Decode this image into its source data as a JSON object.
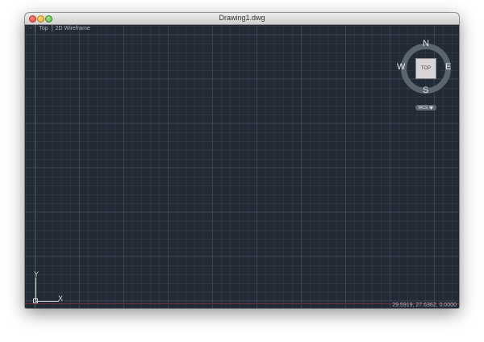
{
  "window": {
    "title": "Drawing1.dwg"
  },
  "viewport": {
    "menu_icon": "-",
    "view_label": "Top",
    "style_label": "2D Wireframe"
  },
  "viewcube": {
    "north": "N",
    "south": "S",
    "east": "E",
    "west": "W",
    "face_label": "TOP",
    "wcs_label": "WCS",
    "wcs_dropdown_icon": "chevron-down-icon"
  },
  "ucs": {
    "y_label": "Y",
    "x_label": "X"
  },
  "status": {
    "coordinates": "29.5919, 27.6362, 0.0000"
  },
  "colors": {
    "canvas_background": "#222a35",
    "x_axis": "#7a2f35",
    "y_axis": "#3f7a3f"
  }
}
